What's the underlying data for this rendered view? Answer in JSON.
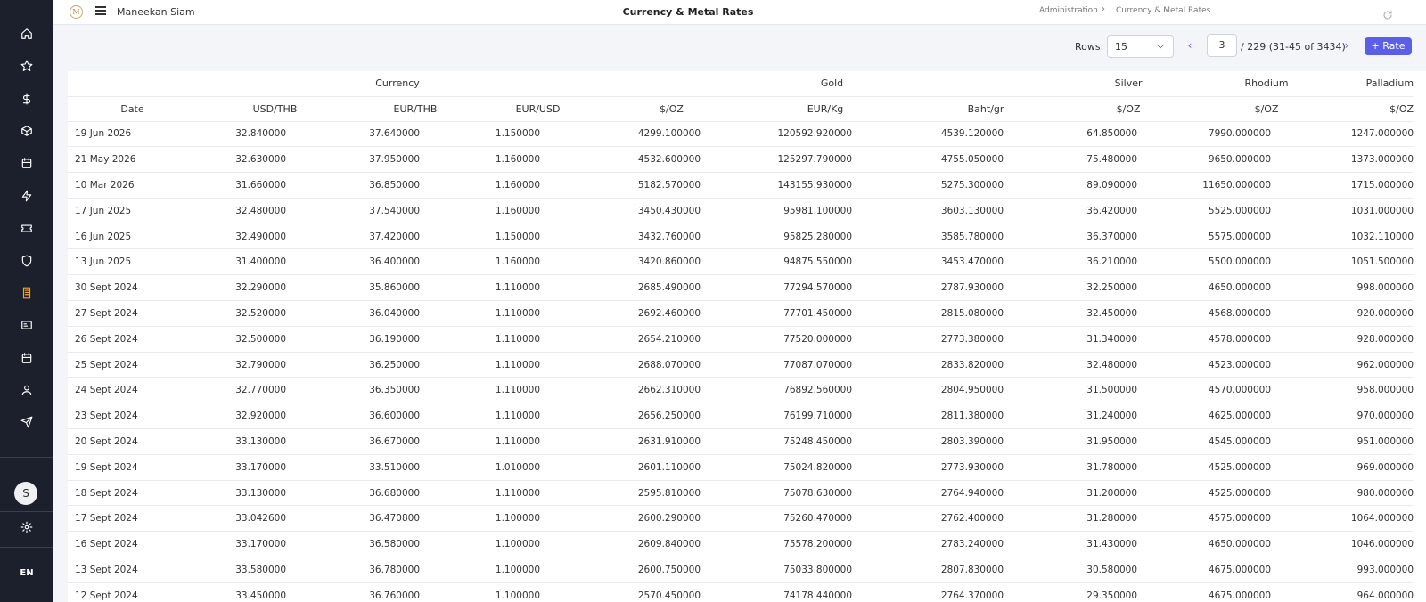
{
  "topbar": {
    "logo_text": "M",
    "company": "Maneekan Siam",
    "title": "Currency & Metal Rates",
    "breadcrumb": [
      "Administration",
      "Currency & Metal Rates"
    ],
    "separator": "›"
  },
  "sidebar": {
    "icons": [
      "home-icon",
      "star-icon",
      "dollar-icon",
      "box-icon",
      "calendar-icon",
      "bolt-icon",
      "ticket-icon",
      "shield-icon",
      "receipt-icon",
      "id-card-icon",
      "calendar-icon",
      "user-icon",
      "send-icon"
    ],
    "active_icon": "receipt-icon",
    "active_color": "#f5a623",
    "avatar_initial": "S",
    "language": "EN"
  },
  "pagination": {
    "rows_label": "Rows:",
    "rows_value": "15",
    "page": "3",
    "page_info": "/ 229 (31-45 of 3434)",
    "add_label": "+ Rate",
    "add_color": "#5b5fe8"
  },
  "table": {
    "groups": {
      "currency": "Currency",
      "gold": "Gold",
      "silver": "Silver",
      "rhodium": "Rhodium",
      "palladium": "Palladium"
    },
    "columns": [
      "Date",
      "USD/THB",
      "EUR/THB",
      "EUR/USD",
      "$/OZ",
      "EUR/Kg",
      "Baht/gr",
      "$/OZ",
      "$/OZ",
      "$/OZ"
    ],
    "rows": [
      [
        "19 Jun 2026",
        "32.840000",
        "37.640000",
        "1.150000",
        "4299.100000",
        "120592.920000",
        "4539.120000",
        "64.850000",
        "7990.000000",
        "1247.000000"
      ],
      [
        "21 May 2026",
        "32.630000",
        "37.950000",
        "1.160000",
        "4532.600000",
        "125297.790000",
        "4755.050000",
        "75.480000",
        "9650.000000",
        "1373.000000"
      ],
      [
        "10 Mar 2026",
        "31.660000",
        "36.850000",
        "1.160000",
        "5182.570000",
        "143155.930000",
        "5275.300000",
        "89.090000",
        "11650.000000",
        "1715.000000"
      ],
      [
        "17 Jun 2025",
        "32.480000",
        "37.540000",
        "1.160000",
        "3450.430000",
        "95981.100000",
        "3603.130000",
        "36.420000",
        "5525.000000",
        "1031.000000"
      ],
      [
        "16 Jun 2025",
        "32.490000",
        "37.420000",
        "1.150000",
        "3432.760000",
        "95825.280000",
        "3585.780000",
        "36.370000",
        "5575.000000",
        "1032.110000"
      ],
      [
        "13 Jun 2025",
        "31.400000",
        "36.400000",
        "1.160000",
        "3420.860000",
        "94875.550000",
        "3453.470000",
        "36.210000",
        "5500.000000",
        "1051.500000"
      ],
      [
        "30 Sept 2024",
        "32.290000",
        "35.860000",
        "1.110000",
        "2685.490000",
        "77294.570000",
        "2787.930000",
        "32.250000",
        "4650.000000",
        "998.000000"
      ],
      [
        "27 Sept 2024",
        "32.520000",
        "36.040000",
        "1.110000",
        "2692.460000",
        "77701.450000",
        "2815.080000",
        "32.450000",
        "4568.000000",
        "920.000000"
      ],
      [
        "26 Sept 2024",
        "32.500000",
        "36.190000",
        "1.110000",
        "2654.210000",
        "77520.000000",
        "2773.380000",
        "31.340000",
        "4578.000000",
        "928.000000"
      ],
      [
        "25 Sept 2024",
        "32.790000",
        "36.250000",
        "1.110000",
        "2688.070000",
        "77087.070000",
        "2833.820000",
        "32.480000",
        "4523.000000",
        "962.000000"
      ],
      [
        "24 Sept 2024",
        "32.770000",
        "36.350000",
        "1.110000",
        "2662.310000",
        "76892.560000",
        "2804.950000",
        "31.500000",
        "4570.000000",
        "958.000000"
      ],
      [
        "23 Sept 2024",
        "32.920000",
        "36.600000",
        "1.110000",
        "2656.250000",
        "76199.710000",
        "2811.380000",
        "31.240000",
        "4625.000000",
        "970.000000"
      ],
      [
        "20 Sept 2024",
        "33.130000",
        "36.670000",
        "1.110000",
        "2631.910000",
        "75248.450000",
        "2803.390000",
        "31.950000",
        "4545.000000",
        "951.000000"
      ],
      [
        "19 Sept 2024",
        "33.170000",
        "33.510000",
        "1.010000",
        "2601.110000",
        "75024.820000",
        "2773.930000",
        "31.780000",
        "4525.000000",
        "969.000000"
      ],
      [
        "18 Sept 2024",
        "33.130000",
        "36.680000",
        "1.110000",
        "2595.810000",
        "75078.630000",
        "2764.940000",
        "31.200000",
        "4525.000000",
        "980.000000"
      ],
      [
        "17 Sept 2024",
        "33.042600",
        "36.470800",
        "1.100000",
        "2600.290000",
        "75260.470000",
        "2762.400000",
        "31.280000",
        "4575.000000",
        "1064.000000"
      ],
      [
        "16 Sept 2024",
        "33.170000",
        "36.580000",
        "1.100000",
        "2609.840000",
        "75578.200000",
        "2783.240000",
        "31.430000",
        "4650.000000",
        "1046.000000"
      ],
      [
        "13 Sept 2024",
        "33.580000",
        "36.780000",
        "1.100000",
        "2600.750000",
        "75033.800000",
        "2807.830000",
        "30.580000",
        "4675.000000",
        "993.000000"
      ],
      [
        "12 Sept 2024",
        "33.450000",
        "36.760000",
        "1.100000",
        "2570.450000",
        "74178.440000",
        "2764.370000",
        "29.350000",
        "4675.000000",
        "964.000000"
      ]
    ]
  }
}
